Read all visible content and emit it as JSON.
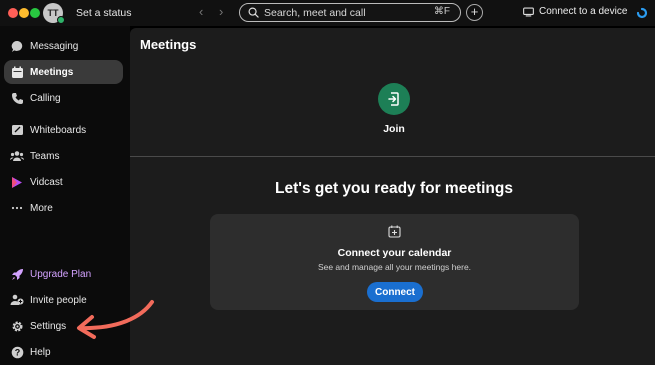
{
  "titlebar": {
    "avatar_initials": "TT",
    "status_label": "Set a status",
    "search_placeholder": "Search, meet and call",
    "search_shortcut": "⌘F",
    "connect_device_label": "Connect to a device"
  },
  "sidebar": {
    "items": [
      {
        "label": "Messaging",
        "icon": "chat-bubble-icon"
      },
      {
        "label": "Meetings",
        "icon": "calendar-icon",
        "active": true
      },
      {
        "label": "Calling",
        "icon": "phone-icon"
      },
      {
        "label": "Whiteboards",
        "icon": "whiteboard-icon"
      },
      {
        "label": "Teams",
        "icon": "people-icon"
      },
      {
        "label": "Vidcast",
        "icon": "vidcast-icon"
      },
      {
        "label": "More",
        "icon": "ellipsis-icon"
      }
    ],
    "bottom_items": [
      {
        "label": "Upgrade Plan",
        "icon": "rocket-icon",
        "color": "#d3a2ff"
      },
      {
        "label": "Invite people",
        "icon": "add-person-icon"
      },
      {
        "label": "Settings",
        "icon": "gear-icon"
      },
      {
        "label": "Help",
        "icon": "help-icon"
      }
    ]
  },
  "main": {
    "title": "Meetings",
    "join_label": "Join",
    "heading": "Let's get you ready for meetings",
    "card": {
      "title": "Connect your calendar",
      "subtitle": "See and manage all your meetings here.",
      "button_label": "Connect"
    }
  },
  "colors": {
    "accent_blue": "#1a6fd0",
    "join_green": "#1d7f56",
    "annotation_arrow": "#f26b5b"
  }
}
